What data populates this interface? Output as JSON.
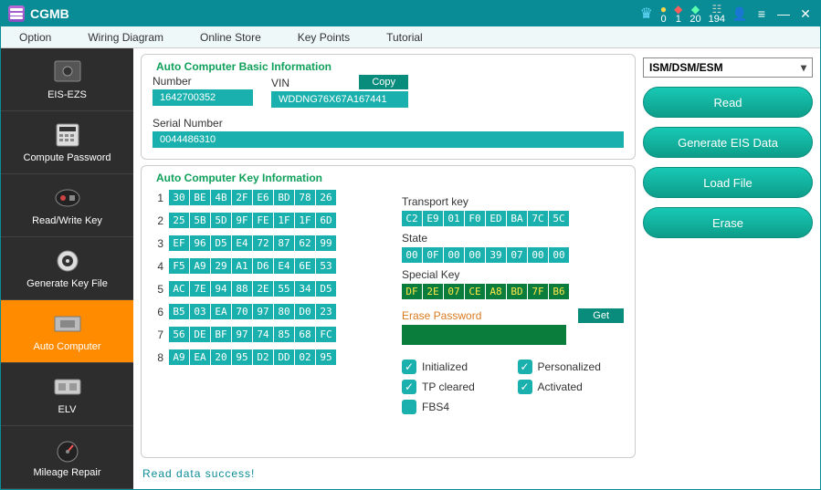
{
  "app": {
    "title": "CGMB"
  },
  "titlebar": {
    "counters": [
      {
        "icon": "●",
        "color": "#ffd54a",
        "value": "0"
      },
      {
        "icon": "◆",
        "color": "#ff5c5c",
        "value": "1"
      },
      {
        "icon": "◆",
        "color": "#5cffb0",
        "value": "20"
      },
      {
        "icon": "▮",
        "color": "#cfcfcf",
        "value": "194"
      }
    ]
  },
  "menu": [
    "Option",
    "Wiring Diagram",
    "Online Store",
    "Key Points",
    "Tutorial"
  ],
  "sidebar": [
    {
      "label": "EIS-EZS"
    },
    {
      "label": "Compute Password"
    },
    {
      "label": "Read/Write Key"
    },
    {
      "label": "Generate Key File"
    },
    {
      "label": "Auto Computer",
      "active": true
    },
    {
      "label": "ELV"
    },
    {
      "label": "Mileage Repair"
    }
  ],
  "basic": {
    "title": "Auto Computer Basic Information",
    "number_label": "Number",
    "number_value": "1642700352",
    "vin_label": "VIN",
    "vin_value": "WDDNG76X67A167441",
    "copy_label": "Copy",
    "serial_label": "Serial Number",
    "serial_value": "0044486310"
  },
  "keyinfo": {
    "title": "Auto Computer Key Information",
    "keys": [
      [
        "30",
        "BE",
        "4B",
        "2F",
        "E6",
        "BD",
        "78",
        "26"
      ],
      [
        "25",
        "5B",
        "5D",
        "9F",
        "FE",
        "1F",
        "1F",
        "6D"
      ],
      [
        "EF",
        "96",
        "D5",
        "E4",
        "72",
        "87",
        "62",
        "99"
      ],
      [
        "F5",
        "A9",
        "29",
        "A1",
        "D6",
        "E4",
        "6E",
        "53"
      ],
      [
        "AC",
        "7E",
        "94",
        "88",
        "2E",
        "55",
        "34",
        "D5"
      ],
      [
        "B5",
        "03",
        "EA",
        "70",
        "97",
        "80",
        "D0",
        "23"
      ],
      [
        "56",
        "DE",
        "BF",
        "97",
        "74",
        "85",
        "68",
        "FC"
      ],
      [
        "A9",
        "EA",
        "20",
        "95",
        "D2",
        "DD",
        "02",
        "95"
      ]
    ],
    "transport_label": "Transport key",
    "transport": [
      "C2",
      "E9",
      "01",
      "F0",
      "ED",
      "BA",
      "7C",
      "5C"
    ],
    "state_label": "State",
    "state": [
      "00",
      "0F",
      "00",
      "00",
      "39",
      "07",
      "00",
      "00"
    ],
    "special_label": "Special Key",
    "special": [
      "DF",
      "2E",
      "07",
      "CE",
      "A8",
      "BD",
      "7F",
      "B6"
    ],
    "erase_label": "Erase Password",
    "get_label": "Get",
    "checks": {
      "initialized": "Initialized",
      "personalized": "Personalized",
      "tp_cleared": "TP cleared",
      "activated": "Activated",
      "fbs4": "FBS4"
    }
  },
  "right": {
    "dropdown": "ISM/DSM/ESM",
    "read": "Read",
    "generate": "Generate EIS Data",
    "load": "Load File",
    "erase": "Erase"
  },
  "status": "Read  data  success!"
}
